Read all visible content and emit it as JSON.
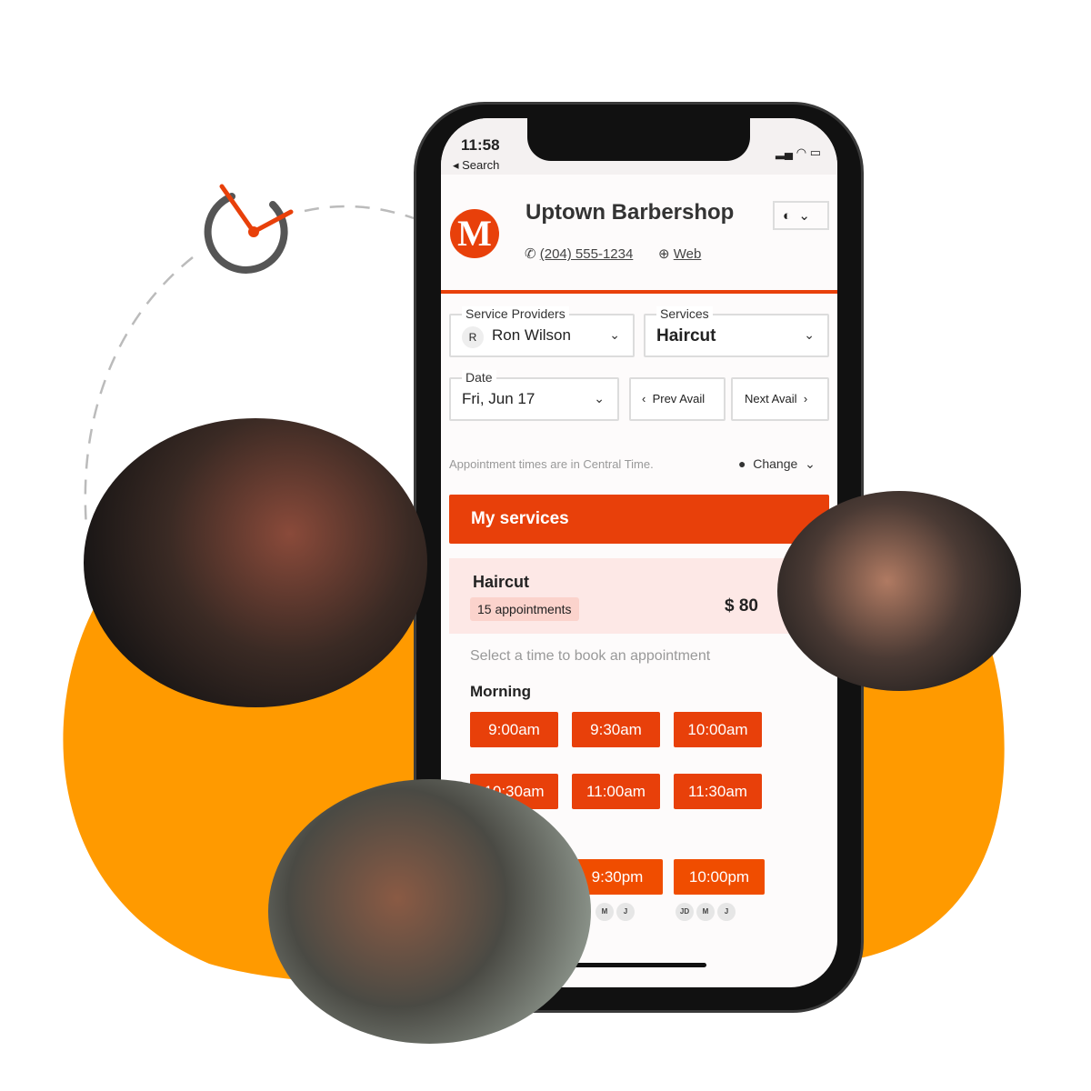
{
  "colors": {
    "accent": "#e8400a",
    "blob": "#ff9a00",
    "clock": "#555555"
  },
  "status": {
    "time": "11:58",
    "back": "Search"
  },
  "header": {
    "logo": "M",
    "title": "Uptown Barbershop",
    "phone": "(204) 555-1234",
    "web": "Web"
  },
  "providers": {
    "label": "Service Providers",
    "avatar": "R",
    "value": "Ron Wilson"
  },
  "services": {
    "label": "Services",
    "value": "Haircut"
  },
  "date": {
    "label": "Date",
    "value": "Fri, Jun 17"
  },
  "nav": {
    "prev": "Prev Avail",
    "next": "Next Avail"
  },
  "timezone": {
    "text": "Appointment times are in Central Time.",
    "change": "Change"
  },
  "my_services": "My services",
  "card": {
    "name": "Haircut",
    "badge": "15 appointments",
    "price": "$ 80"
  },
  "prompt": "Select a time to book an appointment",
  "morning": {
    "label": "Morning",
    "times": [
      "9:00am",
      "9:30am",
      "10:00am",
      "10:30am",
      "11:00am",
      "11:30am"
    ]
  },
  "evening": {
    "times": [
      "9:30pm",
      "10:00pm"
    ],
    "avatars": [
      [
        "M",
        "J"
      ],
      [
        "JD",
        "M",
        "J"
      ]
    ]
  }
}
